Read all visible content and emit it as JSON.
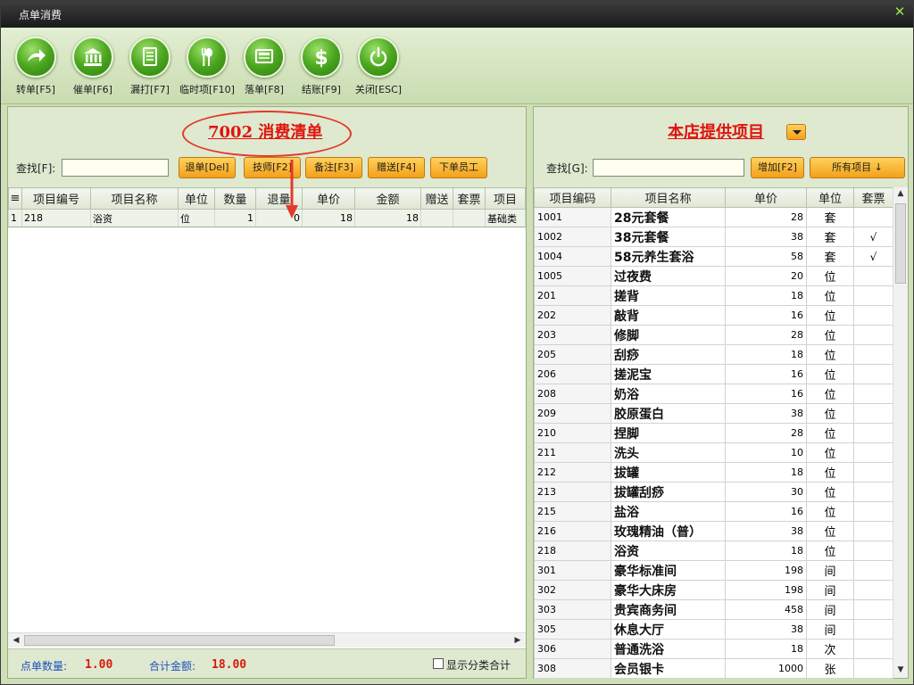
{
  "window": {
    "title": "点单消费"
  },
  "toolbar": {
    "buttons": [
      {
        "label": "转单[F5]",
        "icon": "arrow-forward-icon"
      },
      {
        "label": "催单[F6]",
        "icon": "bank-icon"
      },
      {
        "label": "漏打[F7]",
        "icon": "document-icon"
      },
      {
        "label": "临时项[F10]",
        "icon": "fork-spoon-icon"
      },
      {
        "label": "落单[F8]",
        "icon": "screen-icon"
      },
      {
        "label": "结账[F9]",
        "icon": "dollar-icon"
      },
      {
        "label": "关闭[ESC]",
        "icon": "power-icon"
      }
    ]
  },
  "left": {
    "title": "7002  消费清单",
    "find_label": "查找[F]:",
    "find_value": "",
    "buttons": [
      "退单[Del]",
      "技师[F2]",
      "备注[F3]",
      "赠送[F4]",
      "下单员工"
    ],
    "columns": [
      "≡",
      "项目编号",
      "项目名称",
      "单位",
      "数量",
      "退量",
      "单价",
      "金额",
      "赠送",
      "套票",
      "项目"
    ],
    "rows": [
      {
        "idx": "1",
        "code": "218",
        "name": "浴资",
        "unit": "位",
        "qty": "1",
        "ret": "0",
        "price": "18",
        "amount": "18",
        "gift": "",
        "ticket": "",
        "type": "基础类"
      }
    ],
    "footer": {
      "qty_label": "点单数量:",
      "qty_value": "1.00",
      "sum_label": "合计金额:",
      "sum_value": "18.00",
      "checkbox_label": "显示分类合计",
      "checkbox_checked": false
    }
  },
  "right": {
    "title": "本店提供项目",
    "find_label": "查找[G]:",
    "find_value": "",
    "add_button": "增加[F2]",
    "all_button": "所有项目 ↓",
    "columns": [
      "项目编码",
      "项目名称",
      "单价",
      "单位",
      "套票"
    ],
    "rows": [
      {
        "code": "1001",
        "name": "28元套餐",
        "price": "28",
        "unit": "套",
        "ticket": ""
      },
      {
        "code": "1002",
        "name": "38元套餐",
        "price": "38",
        "unit": "套",
        "ticket": "√"
      },
      {
        "code": "1004",
        "name": "58元养生套浴",
        "price": "58",
        "unit": "套",
        "ticket": "√"
      },
      {
        "code": "1005",
        "name": "过夜费",
        "price": "20",
        "unit": "位",
        "ticket": ""
      },
      {
        "code": "201",
        "name": "搓背",
        "price": "18",
        "unit": "位",
        "ticket": ""
      },
      {
        "code": "202",
        "name": "敲背",
        "price": "16",
        "unit": "位",
        "ticket": ""
      },
      {
        "code": "203",
        "name": "修脚",
        "price": "28",
        "unit": "位",
        "ticket": ""
      },
      {
        "code": "205",
        "name": "刮痧",
        "price": "18",
        "unit": "位",
        "ticket": ""
      },
      {
        "code": "206",
        "name": "搓泥宝",
        "price": "16",
        "unit": "位",
        "ticket": ""
      },
      {
        "code": "208",
        "name": "奶浴",
        "price": "16",
        "unit": "位",
        "ticket": ""
      },
      {
        "code": "209",
        "name": "胶原蛋白",
        "price": "38",
        "unit": "位",
        "ticket": ""
      },
      {
        "code": "210",
        "name": "捏脚",
        "price": "28",
        "unit": "位",
        "ticket": ""
      },
      {
        "code": "211",
        "name": "洗头",
        "price": "10",
        "unit": "位",
        "ticket": ""
      },
      {
        "code": "212",
        "name": "拔罐",
        "price": "18",
        "unit": "位",
        "ticket": ""
      },
      {
        "code": "213",
        "name": "拔罐刮痧",
        "price": "30",
        "unit": "位",
        "ticket": ""
      },
      {
        "code": "215",
        "name": "盐浴",
        "price": "16",
        "unit": "位",
        "ticket": ""
      },
      {
        "code": "216",
        "name": "玫瑰精油（普）",
        "price": "38",
        "unit": "位",
        "ticket": ""
      },
      {
        "code": "218",
        "name": "浴资",
        "price": "18",
        "unit": "位",
        "ticket": ""
      },
      {
        "code": "301",
        "name": "豪华标准间",
        "price": "198",
        "unit": "间",
        "ticket": ""
      },
      {
        "code": "302",
        "name": "豪华大床房",
        "price": "198",
        "unit": "间",
        "ticket": ""
      },
      {
        "code": "303",
        "name": "贵宾商务间",
        "price": "458",
        "unit": "间",
        "ticket": ""
      },
      {
        "code": "305",
        "name": "休息大厅",
        "price": "38",
        "unit": "间",
        "ticket": ""
      },
      {
        "code": "306",
        "name": "普通洗浴",
        "price": "18",
        "unit": "次",
        "ticket": ""
      },
      {
        "code": "308",
        "name": "会员银卡",
        "price": "1000",
        "unit": "张",
        "ticket": ""
      }
    ]
  },
  "colors": {
    "accent_red": "#e0140c",
    "button_orange": "#f3a01b",
    "panel_green": "#cfe0b8",
    "button_green": "#4ca61f",
    "footer_blue": "#1d4fbf"
  }
}
